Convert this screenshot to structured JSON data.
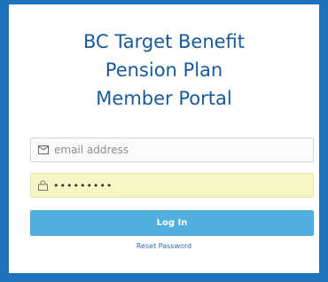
{
  "title": {
    "line1": "BC Target Benefit",
    "line2": "Pension Plan",
    "line3": "Member Portal"
  },
  "email": {
    "placeholder": "email address",
    "value": "",
    "icon": "envelope-icon"
  },
  "password": {
    "value": "xxxxxxxxx",
    "icon": "lock-icon"
  },
  "login_button": {
    "label": "Log In"
  },
  "reset_link": {
    "label": "Reset Password"
  },
  "colors": {
    "background": "#1d73bd",
    "title": "#1a5a99",
    "button": "#52aedf",
    "password_fill": "#f8f6c5",
    "link": "#2a6fb4"
  }
}
